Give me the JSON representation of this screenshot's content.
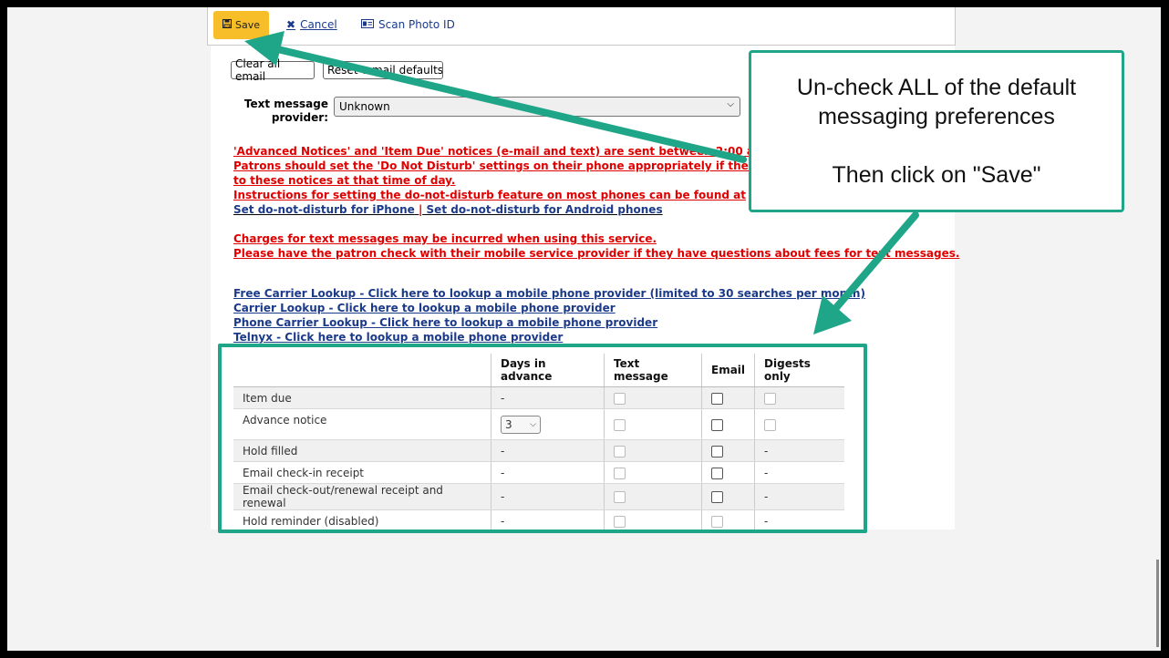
{
  "toolbar": {
    "save_label": "Save",
    "cancel_label": "Cancel",
    "scan_label": "Scan Photo ID"
  },
  "email_buttons": {
    "clear_label": "Clear all email",
    "reset_label": "Reset e-mail defaults"
  },
  "provider": {
    "label_line1": "Text message",
    "label_line2": "provider:",
    "value": "Unknown"
  },
  "notices": {
    "line1": "'Advanced Notices' and 'Item Due' notices (e-mail and text) are sent between 2:00 and 2:30",
    "line2": "Patrons should set the 'Do Not Disturb' settings on their phone appropriately if they do not",
    "line3": "to these notices at that time of day.",
    "line4": "Instructions for setting the do-not-disturb feature on most phones can be found at",
    "iphone_link": "Set do-not-disturb for iPhone",
    "separator": "|",
    "android_link": "Set do-not-disturb for Android phones",
    "charges1": "Charges for text messages may be incurred when using this service.",
    "charges2": "Please have the patron check with their mobile service provider if they have questions about fees for text messages."
  },
  "lookups": [
    "Free Carrier Lookup - Click here to lookup a mobile phone provider (limited to 30 searches per month)",
    "Carrier Lookup - Click here to lookup a mobile phone provider",
    "Phone Carrier Lookup - Click here to lookup a mobile phone provider",
    "Telnyx - Click here to lookup a mobile phone provider"
  ],
  "prefs_table": {
    "headers": [
      "",
      "Days in advance",
      "Text message",
      "Email",
      "Digests only"
    ],
    "rows": [
      {
        "name": "Item due",
        "days": "-",
        "digest": ""
      },
      {
        "name": "Advance notice",
        "days": "3",
        "digest": ""
      },
      {
        "name": "Hold filled",
        "days": "-",
        "digest": "-"
      },
      {
        "name": "Email check-in receipt",
        "days": "-",
        "digest": "-"
      },
      {
        "name": "Email check-out/renewal receipt and renewal",
        "days": "-",
        "digest": "-"
      },
      {
        "name": "Hold reminder (disabled)",
        "days": "-",
        "digest": "-"
      }
    ]
  },
  "callout": {
    "line1": "Un-check ALL of the default",
    "line2": "messaging preferences",
    "line3": "Then click on \"Save\""
  },
  "colors": {
    "accent": "#1fa587",
    "save_button": "#f7be2a",
    "notice_red": "#e00000",
    "link_blue": "#1b3a8a"
  },
  "icons": {
    "save": "floppy-disk-icon",
    "cancel": "x-icon",
    "scan": "id-card-icon"
  }
}
